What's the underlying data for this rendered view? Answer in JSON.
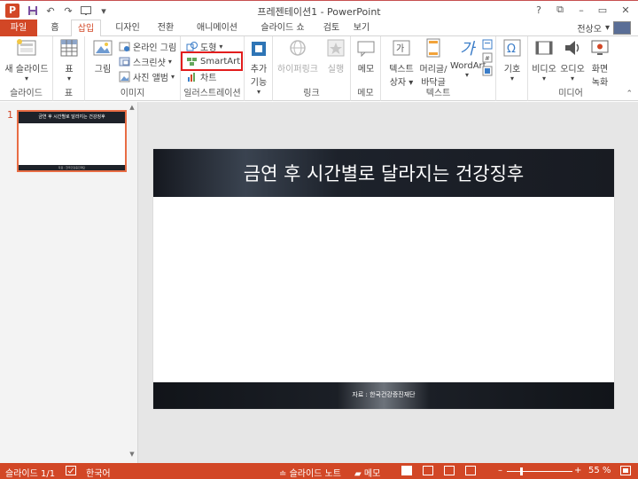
{
  "window": {
    "app_logo": "P",
    "title": "프레젠테이션1 - PowerPoint",
    "help": "?",
    "minimize": "–",
    "restore": "▭",
    "close": "✕",
    "ribbon_display": "⧉"
  },
  "qat": {
    "save": "💾",
    "undo": "↶",
    "redo": "↷",
    "start": "▣",
    "customize": "▾"
  },
  "tabs": [
    {
      "label": "파일"
    },
    {
      "label": "홈"
    },
    {
      "label": "삽입"
    },
    {
      "label": "디자인"
    },
    {
      "label": "전환"
    },
    {
      "label": "애니메이션"
    },
    {
      "label": "슬라이드 쇼"
    },
    {
      "label": "검토"
    },
    {
      "label": "보기"
    }
  ],
  "user": {
    "name": "전상오",
    "dropdown": "▾"
  },
  "ribbon": {
    "groups": {
      "slides": "슬라이드",
      "tables": "표",
      "images": "이미지",
      "illustrations": "일러스트레이션",
      "apps": "",
      "links": "링크",
      "comments": "메모",
      "text": "텍스트",
      "symbols": "",
      "media": "미디어"
    },
    "new_slide": "새 슬라이드",
    "table": "표",
    "pictures": "그림",
    "online_pictures": "온라인 그림",
    "screenshot": "스크린샷",
    "photo_album": "사진 앨범",
    "shapes": "도형",
    "smartart": "SmartArt",
    "chart": "차트",
    "addins": "추가 기능",
    "hyperlink": "하이퍼링크",
    "action": "실행",
    "comment": "메모",
    "textbox_1": "텍스트",
    "textbox_2": "상자",
    "header_footer_1": "머리글/",
    "header_footer_2": "바닥글",
    "wordart": "WordArt",
    "symbols": "기호",
    "video": "비디오",
    "audio": "오디오",
    "screen_recording_1": "화면",
    "screen_recording_2": "녹화",
    "collapse": "⌃"
  },
  "thumbnails": {
    "number": "1",
    "title": "금연 후 시간별로 달라지는 건강징후",
    "footer": "자료 : 한국건강증진재단"
  },
  "slide": {
    "title": "금연 후 시간별로 달라지는 건강징후",
    "source": "자료 : 한국건강증진재단"
  },
  "statusbar": {
    "slide_counter": "슬라이드 1/1",
    "language": "한국어",
    "notes": "슬라이드 노트",
    "comments": "메모",
    "zoom_minus": "–",
    "zoom_plus": "+",
    "zoom_level": "55 %",
    "zoom_value": 0.55
  },
  "colors": {
    "accent": "#d24726",
    "highlight": "#e21d1d"
  }
}
